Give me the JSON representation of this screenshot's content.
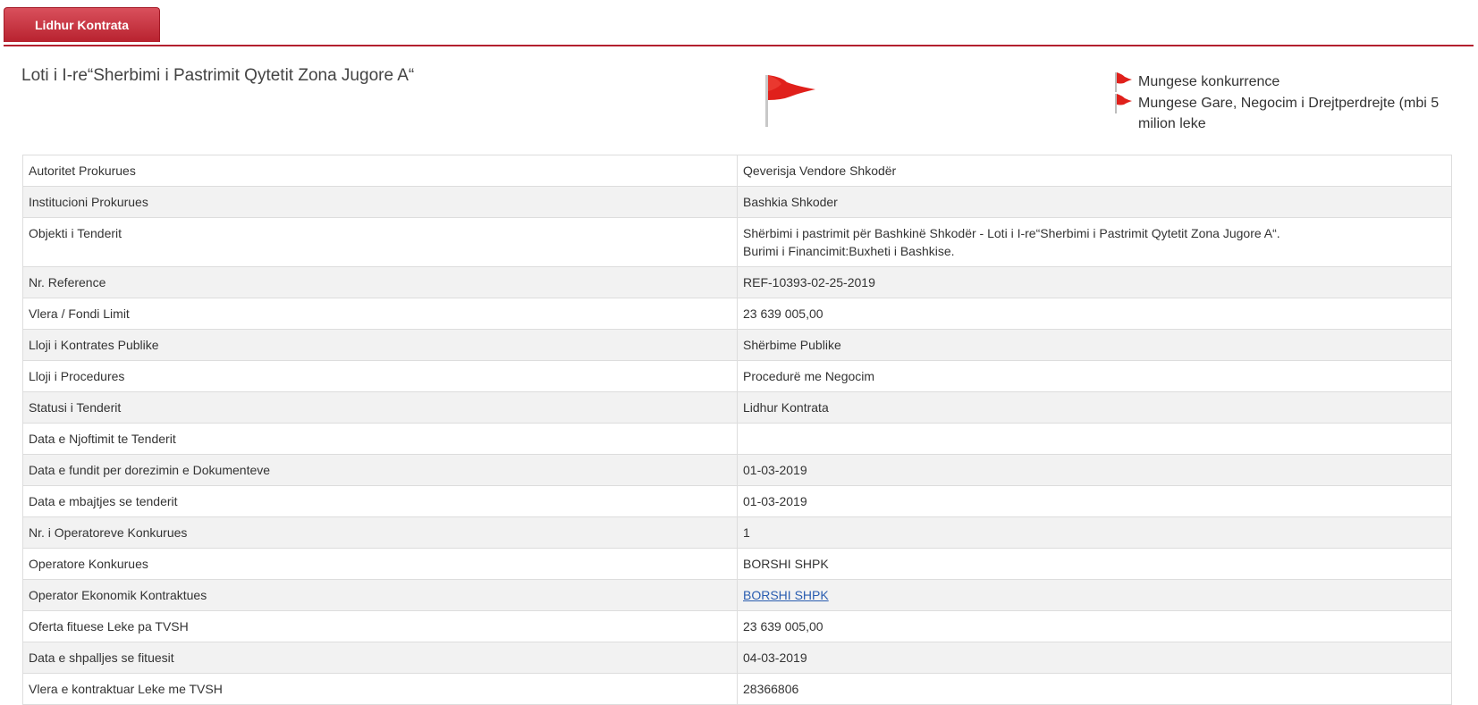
{
  "tab": {
    "label": "Lidhur Kontrata"
  },
  "header": {
    "title": "Loti i I-re“Sherbimi i Pastrimit Qytetit Zona Jugore A“",
    "flags": [
      {
        "label": "Mungese konkurrence"
      },
      {
        "label": "Mungese Gare, Negocim i Drejtperdrejte (mbi 5 milion leke"
      }
    ]
  },
  "colors": {
    "accent": "#b8222f",
    "flag": "#e0201b",
    "link": "#2a5db0"
  },
  "details": [
    {
      "label": "Autoritet Prokurues",
      "value": "Qeverisja Vendore Shkodër"
    },
    {
      "label": "Institucioni Prokurues",
      "value": "Bashkia Shkoder"
    },
    {
      "label": "Objekti i Tenderit",
      "value": "Shërbimi i pastrimit për Bashkinë Shkodër - Loti i I-re“Sherbimi i Pastrimit Qytetit Zona Jugore A“.",
      "value2": "Burimi i Financimit:Buxheti i Bashkise."
    },
    {
      "label": "Nr. Reference",
      "value": "REF-10393-02-25-2019"
    },
    {
      "label": "Vlera / Fondi Limit",
      "value": "23 639 005,00"
    },
    {
      "label": "Lloji i Kontrates Publike",
      "value": "Shërbime Publike"
    },
    {
      "label": "Lloji i Procedures",
      "value": "Procedurë me Negocim"
    },
    {
      "label": "Statusi i Tenderit",
      "value": "Lidhur Kontrata"
    },
    {
      "label": "Data e Njoftimit te Tenderit",
      "value": ""
    },
    {
      "label": "Data e fundit per dorezimin e Dokumenteve",
      "value": "01-03-2019"
    },
    {
      "label": "Data e mbajtjes se tenderit",
      "value": "01-03-2019"
    },
    {
      "label": "Nr. i Operatoreve Konkurues",
      "value": "1"
    },
    {
      "label": "Operatore Konkurues",
      "value": "BORSHI SHPK"
    },
    {
      "label": "Operator Ekonomik Kontraktues",
      "value": "BORSHI SHPK"
    },
    {
      "label": "Oferta fituese Leke pa TVSH",
      "value": "23 639 005,00"
    },
    {
      "label": "Data e shpalljes se fituesit",
      "value": "04-03-2019"
    },
    {
      "label": "Vlera e kontraktuar Leke me TVSH",
      "value": "28366806"
    }
  ]
}
